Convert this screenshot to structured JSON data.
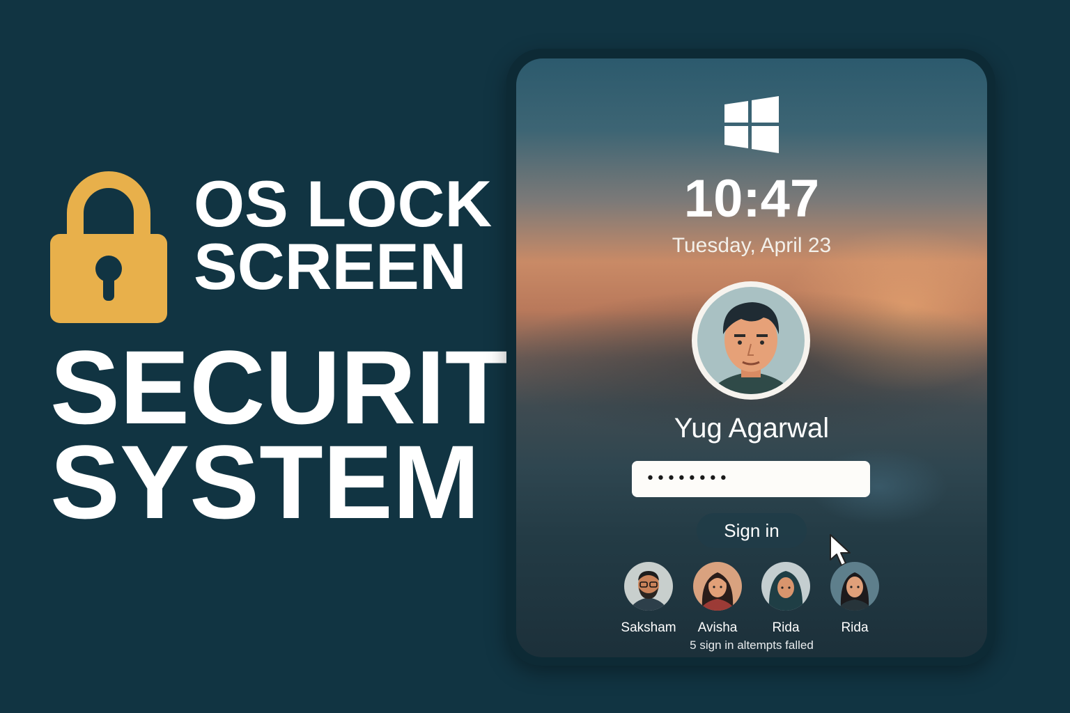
{
  "hero": {
    "line1": "OS LOCK",
    "line2": "SCREEN",
    "line3": "SECURITY",
    "line4": "SYSTEM",
    "lock_color": "#E8B04B"
  },
  "lockscreen": {
    "os_logo": "windows-logo-icon",
    "time": "10:47",
    "date": "Tuesday, April 23",
    "current_user": "Yug Agarwal",
    "password_value": "••••••••",
    "sign_in_label": "Sign in",
    "other_users": [
      {
        "name": "Saksham"
      },
      {
        "name": "Avisha"
      },
      {
        "name": "Rida"
      },
      {
        "name": "Rida"
      }
    ],
    "status": "5 sign in altempts falled"
  },
  "colors": {
    "background": "#113442",
    "device_frame": "#0D2A35",
    "accent_lock": "#E8B04B"
  }
}
